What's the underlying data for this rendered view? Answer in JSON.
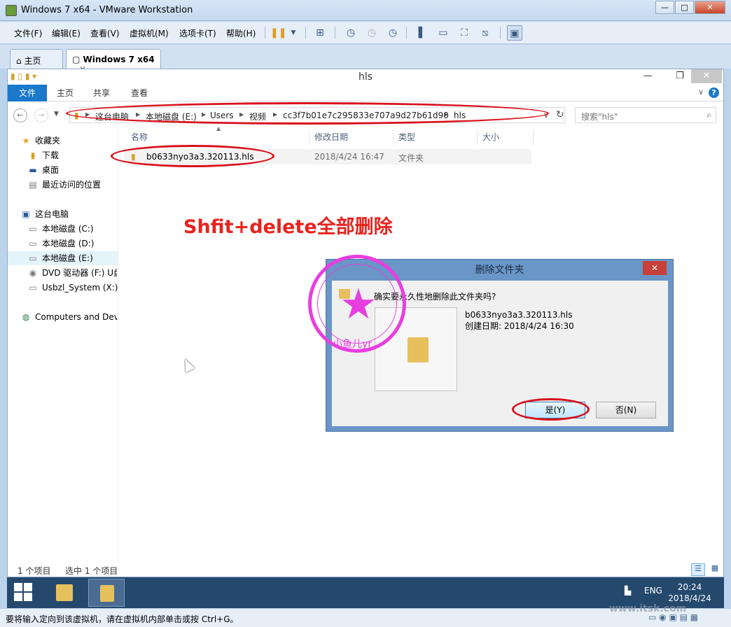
{
  "vm": {
    "title": "Windows 7 x64 - VMware Workstation",
    "menu": [
      "文件(F)",
      "编辑(E)",
      "查看(V)",
      "虚拟机(M)",
      "选项卡(T)",
      "帮助(H)"
    ],
    "tabs": [
      {
        "label": "主页",
        "close": "✕"
      },
      {
        "label": "Windows 7 x64",
        "close": "✕"
      }
    ],
    "status_message": "要将输入定向到该虚拟机，请在虚拟机内部单击或按 Ctrl+G。"
  },
  "explorer": {
    "title": "hls",
    "ribbon_tabs": [
      "文件",
      "主页",
      "共享",
      "查看"
    ],
    "breadcrumb": [
      "这台电脑",
      "本地磁盘 (E:)",
      "Users",
      "视频",
      "cc3f7b01e7c295833e707a9d27b61d90",
      "hls"
    ],
    "search_placeholder": "搜索\"hls\"",
    "nav": {
      "favorites": "收藏夹",
      "fav_items": [
        "下载",
        "桌面",
        "最近访问的位置"
      ],
      "this_pc": "这台电脑",
      "drives": [
        "本地磁盘 (C:)",
        "本地磁盘 (D:)",
        "本地磁盘 (E:)",
        "DVD 驱动器 (F:) U盘",
        "Usbzl_System (X:)"
      ],
      "network": "Computers and Dev"
    },
    "columns": [
      "名称",
      "修改日期",
      "类型",
      "大小"
    ],
    "files": [
      {
        "name": "b0633nyo3a3.320113.hls",
        "date": "2018/4/24 16:47",
        "type": "文件夹",
        "size": ""
      }
    ],
    "status_items": "1 个项目",
    "status_selected": "选中 1 个项目"
  },
  "annotation": {
    "text": "Shfit+delete全部删除",
    "color": "#e8231e"
  },
  "stamp": {
    "outer_text": "www.itsk.com",
    "name": "小鱼儿yr",
    "color": "#e83ee0"
  },
  "dialog": {
    "title": "删除文件夹",
    "question": "确实要永久性地删除此文件夹吗?",
    "file_name": "b0633nyo3a3.320113.hls",
    "created": "创建日期: 2018/4/24 16:30",
    "yes": "是(Y)",
    "no": "否(N)"
  },
  "taskbar": {
    "lang": "ENG",
    "time": "20:24",
    "date": "2018/4/24"
  },
  "watermark": "www.itsk.com"
}
